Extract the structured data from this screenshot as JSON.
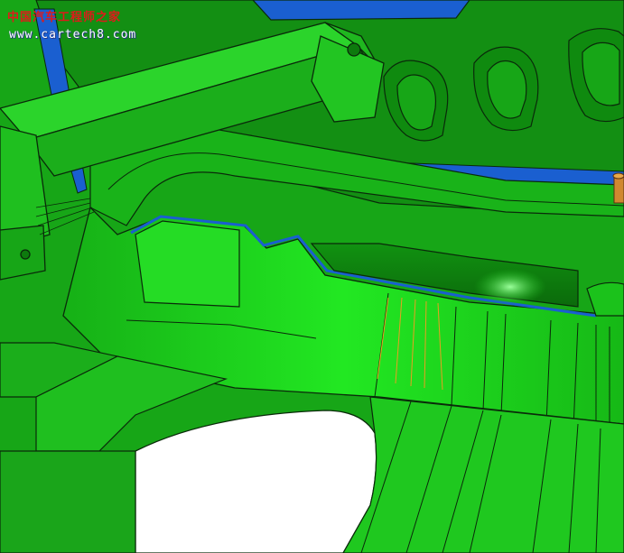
{
  "watermark": {
    "title": "中国汽车工程师之家",
    "url": "www.cartech8.com",
    "title_color": "#e01a1a",
    "url_color": "#ffffff"
  },
  "colors": {
    "green_bright": "#22e822",
    "green_mid": "#1bc21b",
    "green_dark": "#0f8a0f",
    "green_shadow": "#0b6a0b",
    "blue_face": "#1a5fd0",
    "edge_line": "#0a2a0a",
    "highlight_line": "#e8a020",
    "pin_color": "#d08830",
    "void_white": "#ffffff"
  }
}
